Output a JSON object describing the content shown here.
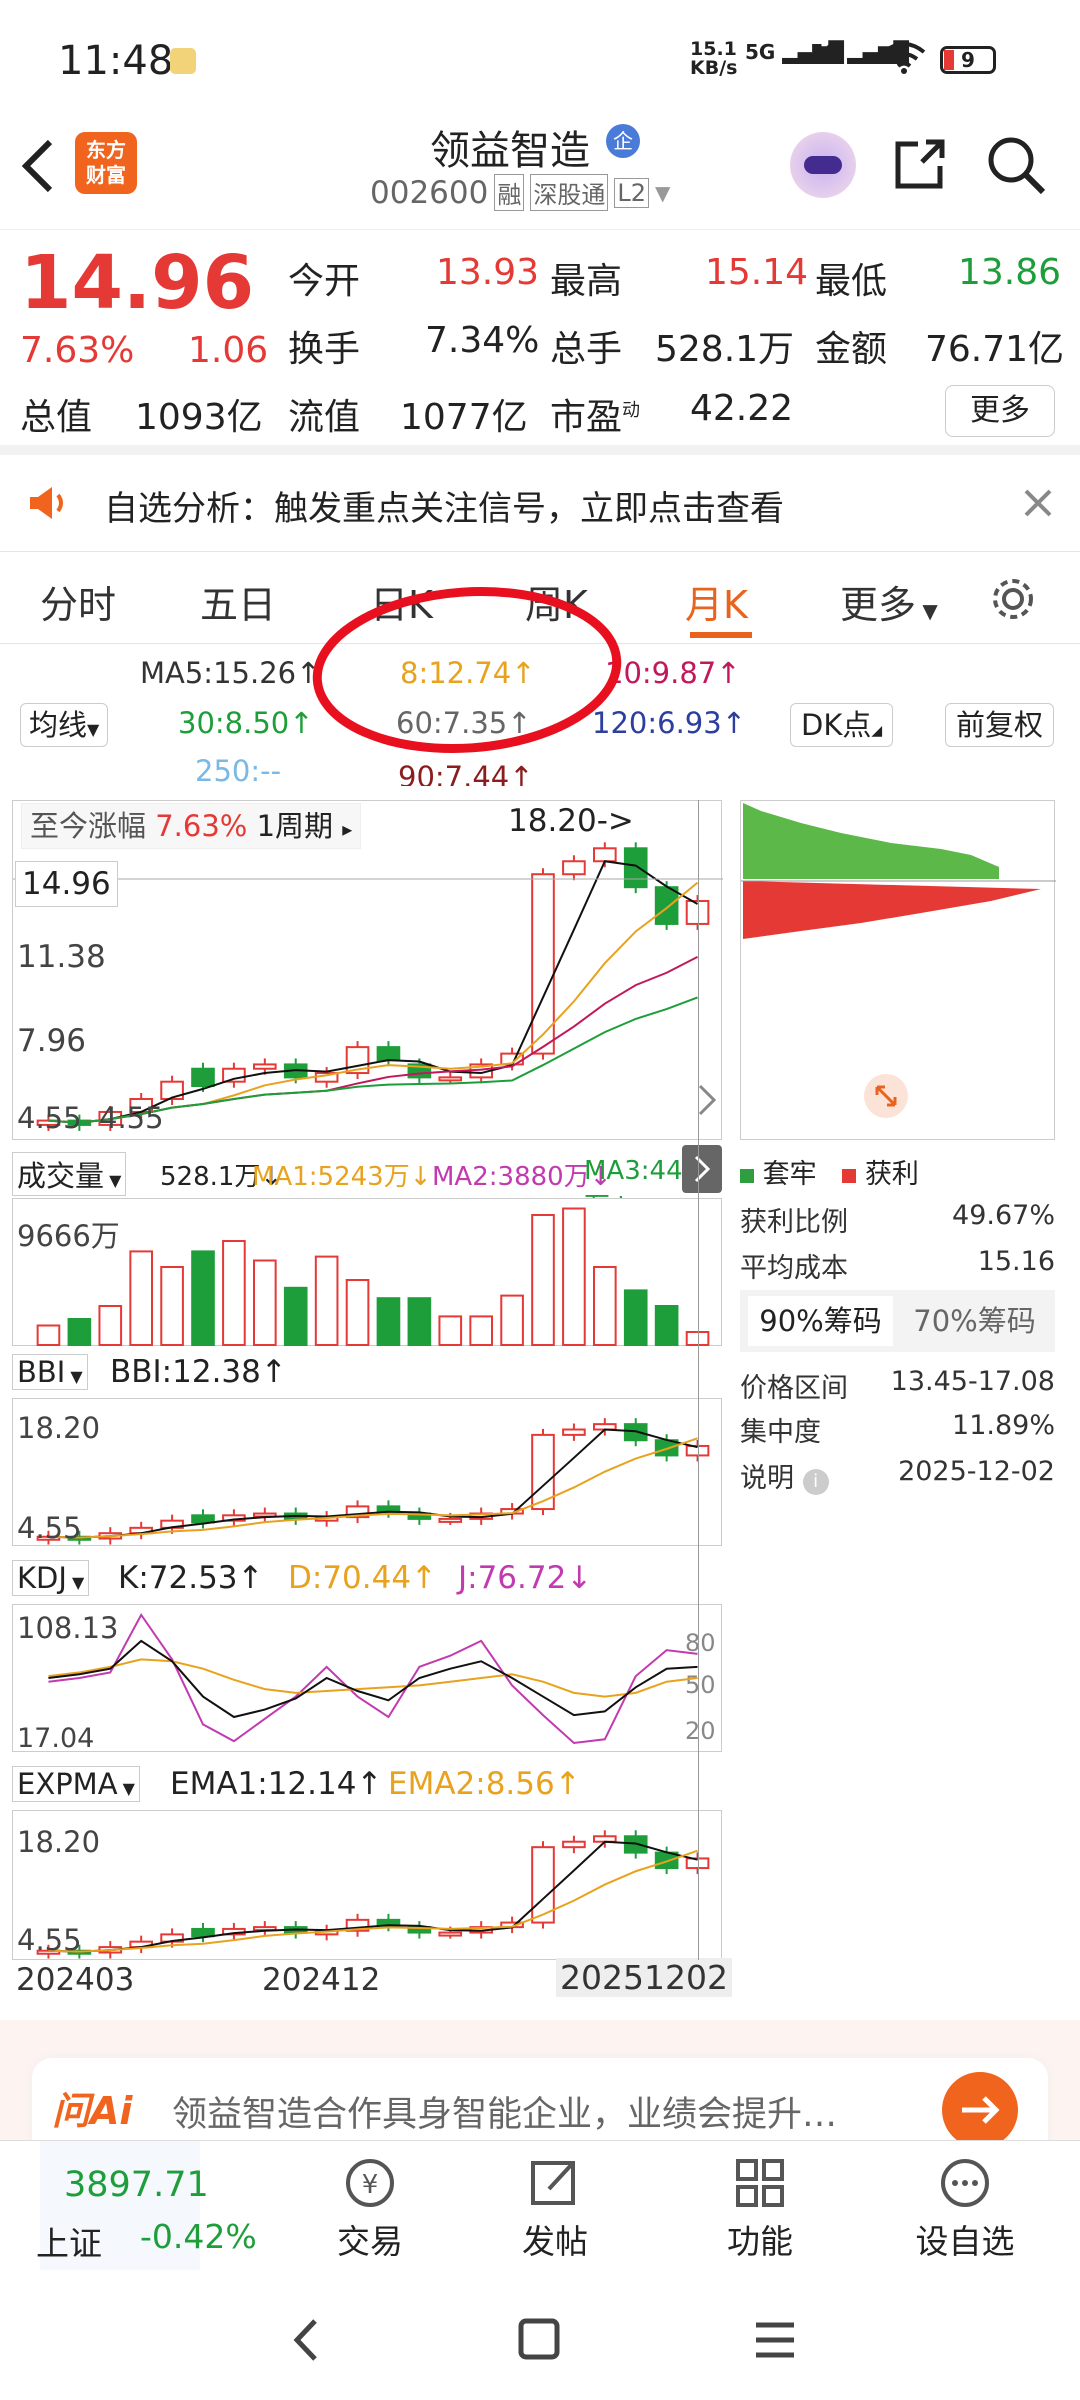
{
  "status": {
    "time": "11:48",
    "net_speed_top": "15.1",
    "net_speed_unit": "KB/s",
    "net1": "5G",
    "net2": "5G",
    "battery": "9"
  },
  "header": {
    "logo_line1": "东方",
    "logo_line2": "财富",
    "stock_name": "领益智造",
    "badge": "企",
    "code": "002600",
    "tag1": "融",
    "tag2": "深股通",
    "tag3": "L2"
  },
  "quote": {
    "price": "14.96",
    "change_pct": "7.63%",
    "change": "1.06",
    "open_label": "今开",
    "open": "13.93",
    "high_label": "最高",
    "high": "15.14",
    "low_label": "最低",
    "low": "13.86",
    "turnover_label": "换手",
    "turnover": "7.34%",
    "vol_label": "总手",
    "vol": "528.1万",
    "amount_label": "金额",
    "amount": "76.71亿",
    "mcap_label": "总值",
    "mcap": "1093亿",
    "float_label": "流值",
    "float": "1077亿",
    "pe_label": "市盈",
    "pe_sup": "动",
    "pe": "42.22",
    "more": "更多"
  },
  "notice": {
    "text": "自选分析：触发重点关注信号，立即点击查看"
  },
  "tabs": {
    "t1": "分时",
    "t2": "五日",
    "t3": "日K",
    "t4": "周K",
    "t5": "月K",
    "t6": "更多"
  },
  "ma": {
    "ma5": "MA5:15.26↑",
    "ma10": "10:9.87↑",
    "ma8": "8:12.74↑",
    "ma30": "30:8.50↑",
    "ma60": "60:7.35↑",
    "ma120": "120:6.93↑",
    "ma250": "250:--",
    "ma90": "90:7.44↑",
    "sel": "均线",
    "dk": "DK点",
    "fq": "前复权"
  },
  "kline": {
    "range_label": "至今涨幅",
    "range_pct": "7.63%",
    "period": "1周期",
    "peak": "18.20->",
    "cur": "14.96",
    "y1": "11.38",
    "y2": "7.96",
    "low": "4.55",
    "low2": "4.55"
  },
  "volume": {
    "name": "成交量",
    "v": "528.1万↓",
    "ma1": "MA1:5243万↓",
    "ma2": "MA2:3880万↓",
    "ma3": "MA3:4437万↓",
    "y": "9666万"
  },
  "bbi": {
    "name": "BBI",
    "v": "BBI:12.38↑",
    "top": "18.20",
    "bot": "4.55"
  },
  "kdj": {
    "name": "KDJ",
    "k": "K:72.53↑",
    "d": "D:70.44↑",
    "j": "J:76.72↓",
    "top": "108.13",
    "bot": "17.04",
    "r80": "80",
    "r50": "50",
    "r20": "20"
  },
  "expma": {
    "name": "EXPMA",
    "e1": "EMA1:12.14↑",
    "e2": "EMA2:8.56↑",
    "top": "18.20",
    "bot": "4.55"
  },
  "xaxis": {
    "a": "202403",
    "b": "202412",
    "c": "20251202"
  },
  "chip": {
    "legend1": "套牢",
    "legend2": "获利",
    "profit_label": "获利比例",
    "profit": "49.67%",
    "avg_label": "平均成本",
    "avg": "15.16",
    "tab1": "90%筹码",
    "tab2": "70%筹码",
    "range_label": "价格区间",
    "range": "13.45-17.08",
    "conc_label": "集中度",
    "conc": "11.89%",
    "note_label": "说明",
    "date": "2025-12-02"
  },
  "ai": {
    "logo": "问Ai",
    "text": "领益智造合作具身智能企业，业绩会提升…"
  },
  "bottom": {
    "index": "3897.71",
    "index_name": "上证",
    "index_chg": "-0.42%",
    "b1": "交易",
    "b2": "发帖",
    "b3": "功能",
    "b4": "设自选"
  },
  "chart_data": {
    "type": "candlestick",
    "period": "monthly",
    "ohlc_approx": [
      {
        "o": 4.6,
        "c": 4.8
      },
      {
        "o": 4.8,
        "c": 4.6
      },
      {
        "o": 4.6,
        "c": 5.2
      },
      {
        "o": 5.2,
        "c": 5.8
      },
      {
        "o": 5.8,
        "c": 6.6
      },
      {
        "o": 7.2,
        "c": 6.4
      },
      {
        "o": 6.6,
        "c": 7.2
      },
      {
        "o": 7.2,
        "c": 7.4
      },
      {
        "o": 7.4,
        "c": 6.8
      },
      {
        "o": 6.6,
        "c": 7.0
      },
      {
        "o": 7.0,
        "c": 8.2
      },
      {
        "o": 8.2,
        "c": 7.6
      },
      {
        "o": 7.4,
        "c": 6.8
      },
      {
        "o": 6.8,
        "c": 6.8
      },
      {
        "o": 6.8,
        "c": 7.4
      },
      {
        "o": 7.4,
        "c": 7.9
      },
      {
        "o": 7.9,
        "c": 16.2
      },
      {
        "o": 16.2,
        "c": 16.8
      },
      {
        "o": 16.8,
        "c": 17.4
      },
      {
        "o": 17.4,
        "c": 15.6
      },
      {
        "o": 15.6,
        "c": 13.9
      },
      {
        "o": 13.9,
        "c": 14.96
      }
    ],
    "ylim": [
      4.55,
      18.2
    ]
  }
}
